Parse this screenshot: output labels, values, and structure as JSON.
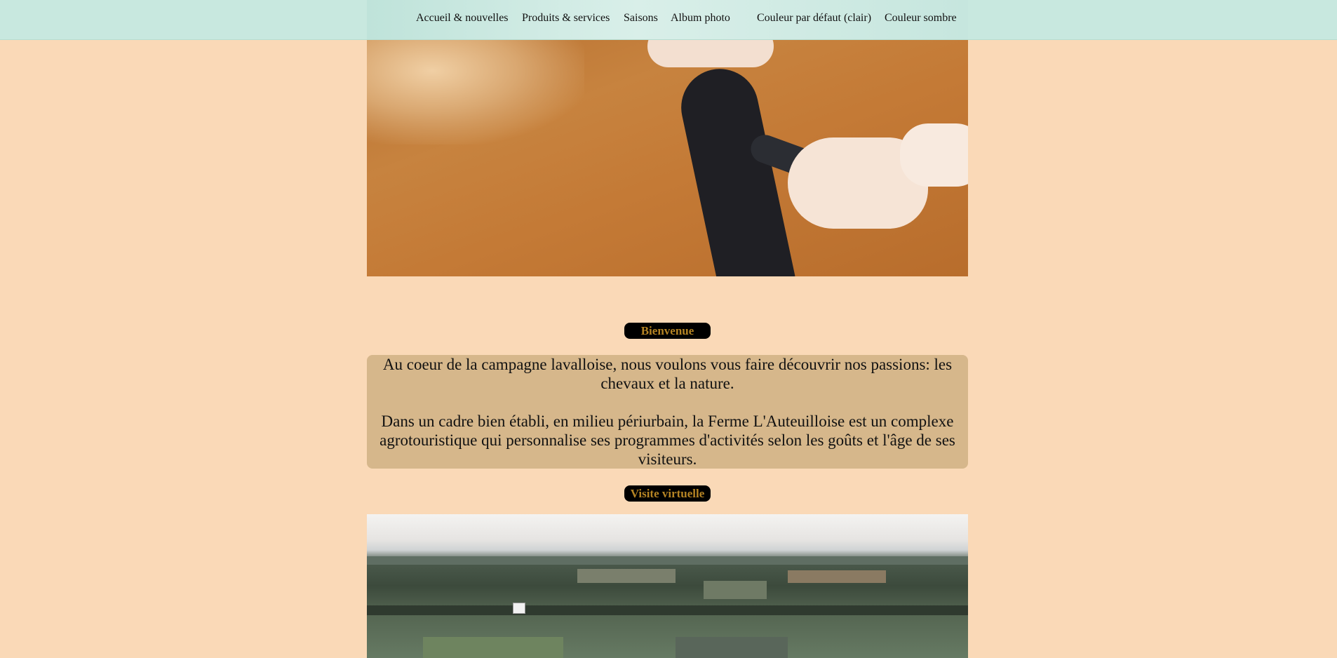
{
  "nav": {
    "items": [
      {
        "id": "accueil",
        "label": "Accueil & nouvelles"
      },
      {
        "id": "produits",
        "label": "Produits & services"
      },
      {
        "id": "saisons",
        "label": "Saisons"
      },
      {
        "id": "album",
        "label": "Album photo"
      },
      {
        "id": "clair",
        "label": "Couleur par défaut (clair)"
      },
      {
        "id": "sombre",
        "label": "Couleur sombre"
      }
    ]
  },
  "sections": {
    "welcome_title": "Bienvenue",
    "welcome_paragraph_1": "Au coeur de la campagne lavalloise, nous voulons vous faire découvrir nos passions: les chevaux et la nature.",
    "welcome_paragraph_2": "Dans un cadre bien établi, en milieu périurbain, la Ferme L'Auteuilloise est un complexe agrotouristique qui personnalise ses programmes d'activités selon les goûts et l'âge de ses visiteurs.",
    "virtual_tour_title": "Visite virtuelle"
  },
  "colors": {
    "page_background": "#fad9b7",
    "topbar": "#c8e8df",
    "pill_background": "#000000",
    "pill_text": "#b58424",
    "box_background": "#d6b78b"
  },
  "images": {
    "hero": "horse-grooming-photo",
    "landscape": "aerial-farmland-photo"
  }
}
